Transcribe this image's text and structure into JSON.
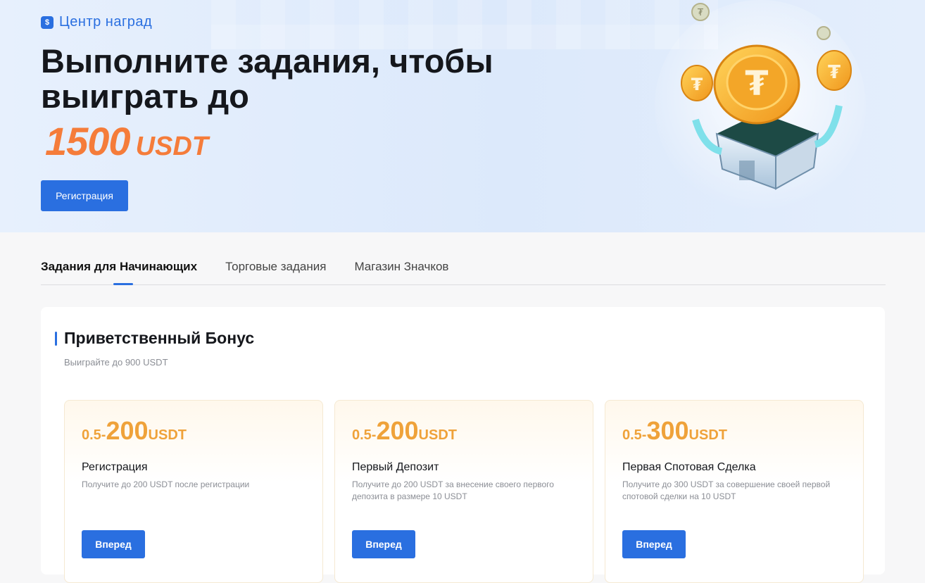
{
  "hero": {
    "breadcrumb_icon": "gift-icon",
    "breadcrumb": "Центр наград",
    "title": "Выполните задания, чтобы выиграть до",
    "amount": "1500",
    "currency": "USDT",
    "register_button": "Регистрация"
  },
  "tabs": [
    {
      "label": "Задания для Начинающих",
      "active": true
    },
    {
      "label": "Торговые задания",
      "active": false
    },
    {
      "label": "Магазин Значков",
      "active": false
    }
  ],
  "panel": {
    "title": "Приветственный Бонус",
    "subtitle": "Выиграйте до 900 USDT"
  },
  "cards": [
    {
      "min": "0.5-",
      "max": "200",
      "unit": "USDT",
      "title": "Регистрация",
      "desc": "Получите до 200 USDT после регистрации",
      "button": "Вперед"
    },
    {
      "min": "0.5-",
      "max": "200",
      "unit": "USDT",
      "title": "Первый Депозит",
      "desc": "Получите до 200 USDT за внесение своего первого депозита в размере 10 USDT",
      "button": "Вперед"
    },
    {
      "min": "0.5-",
      "max": "300",
      "unit": "USDT",
      "title": "Первая Спотовая Сделка",
      "desc": "Получите до 300 USDT за совершение своей первой спотовой сделки на 10 USDT",
      "button": "Вперед"
    }
  ],
  "colors": {
    "accent": "#2a6fe0",
    "highlight_orange": "#f57c3a",
    "reward_gold": "#efa23a"
  }
}
